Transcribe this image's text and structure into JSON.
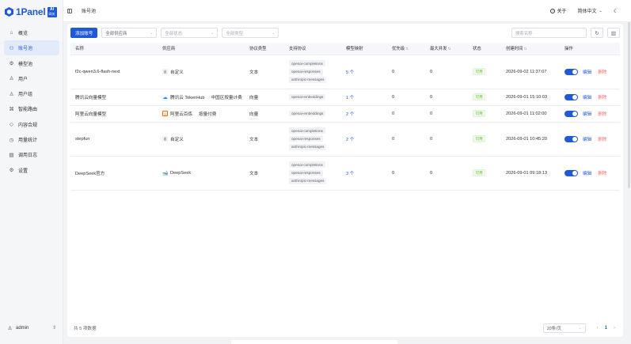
{
  "app": {
    "logo_text": "1Panel",
    "logo_badge_top": "AI",
    "logo_badge_bottom": "网关"
  },
  "sidebar": {
    "items": [
      {
        "label": "概览",
        "icon": "home-icon",
        "glyph": "⌂",
        "active": false
      },
      {
        "label": "账号池",
        "icon": "user-group-icon",
        "glyph": "⚇",
        "active": true
      },
      {
        "label": "模型池",
        "icon": "cube-icon",
        "glyph": "⚙",
        "active": false
      },
      {
        "label": "用户",
        "icon": "user-icon",
        "glyph": "♙",
        "active": false
      },
      {
        "label": "用户组",
        "icon": "users-icon",
        "glyph": "♙",
        "active": false
      },
      {
        "label": "智能路由",
        "icon": "route-icon",
        "glyph": "⌘",
        "active": false
      },
      {
        "label": "内容合规",
        "icon": "shield-icon",
        "glyph": "◇",
        "active": false
      },
      {
        "label": "用量统计",
        "icon": "chart-icon",
        "glyph": "◷",
        "active": false
      },
      {
        "label": "调用日志",
        "icon": "log-icon",
        "glyph": "▤",
        "active": false
      },
      {
        "label": "设置",
        "icon": "gear-icon",
        "glyph": "⚙",
        "active": false
      }
    ],
    "user": {
      "name": "admin",
      "icon": "user-avatar-icon"
    }
  },
  "header": {
    "title": "账号池",
    "about": "关于",
    "language": "简体中文",
    "theme_icon": "moon-icon"
  },
  "toolbar": {
    "add_label": "添加账号",
    "filter_provider": "全部供应商",
    "filter_status": "全部状态",
    "filter_type": "全部类型",
    "search_placeholder": "搜索名称"
  },
  "table": {
    "columns": [
      "名称",
      "供应商",
      "协议类型",
      "支持协议",
      "模型映射",
      "优先级",
      "最大并发",
      "状态",
      "创建时间",
      "操作"
    ],
    "rows": [
      {
        "name": "f2c-qwen3.6-flash-next",
        "provider": "自定义",
        "provider_icon": "custom",
        "provider_extra": "",
        "type": "文本",
        "protocols": [
          "openai-completions",
          "openai-responses",
          "anthropic-messages"
        ],
        "mapping": "5 个",
        "priority": "0",
        "concurrency": "0",
        "status": "可用",
        "created": "2026-09-02 11:37:07",
        "edit": "编辑",
        "delete": "删除"
      },
      {
        "name": "腾讯云向量模型",
        "provider": "腾讯云 TokenHub",
        "provider_icon": "tencent",
        "provider_extra": "中国区按量计费",
        "type": "向量",
        "protocols": [
          "openai-embeddings"
        ],
        "mapping": "1 个",
        "priority": "0",
        "concurrency": "0",
        "status": "可用",
        "created": "2026-09-01 15:10:03",
        "edit": "编辑",
        "delete": "删除"
      },
      {
        "name": "阿里云向量模型",
        "provider": "阿里云百炼",
        "provider_icon": "aliyun",
        "provider_extra": "按量付费",
        "type": "向量",
        "protocols": [
          "openai-embeddings"
        ],
        "mapping": "2 个",
        "priority": "0",
        "concurrency": "0",
        "status": "可用",
        "created": "2026-09-01 11:02:00",
        "edit": "编辑",
        "delete": "删除"
      },
      {
        "name": "stepfun",
        "provider": "自定义",
        "provider_icon": "custom",
        "provider_extra": "",
        "type": "文本",
        "protocols": [
          "openai-completions",
          "openai-responses",
          "anthropic-messages"
        ],
        "mapping": "2 个",
        "priority": "0",
        "concurrency": "0",
        "status": "可用",
        "created": "2026-09-01 10:45:20",
        "edit": "编辑",
        "delete": "删除"
      },
      {
        "name": "DeepSeek官方",
        "provider": "DeepSeek",
        "provider_icon": "deepseek",
        "provider_extra": "",
        "type": "文本",
        "protocols": [
          "openai-completions",
          "openai-responses",
          "anthropic-messages"
        ],
        "mapping": "3 个",
        "priority": "0",
        "concurrency": "0",
        "status": "可用",
        "created": "2026-09-01 09:18:13",
        "edit": "编辑",
        "delete": "删除"
      }
    ]
  },
  "footer": {
    "total": "共 5 项数据",
    "page_size": "20条/页",
    "current_page": "1"
  },
  "colors": {
    "primary": "#1f59d8",
    "danger": "#f56c6c",
    "success": "#67c23a"
  }
}
